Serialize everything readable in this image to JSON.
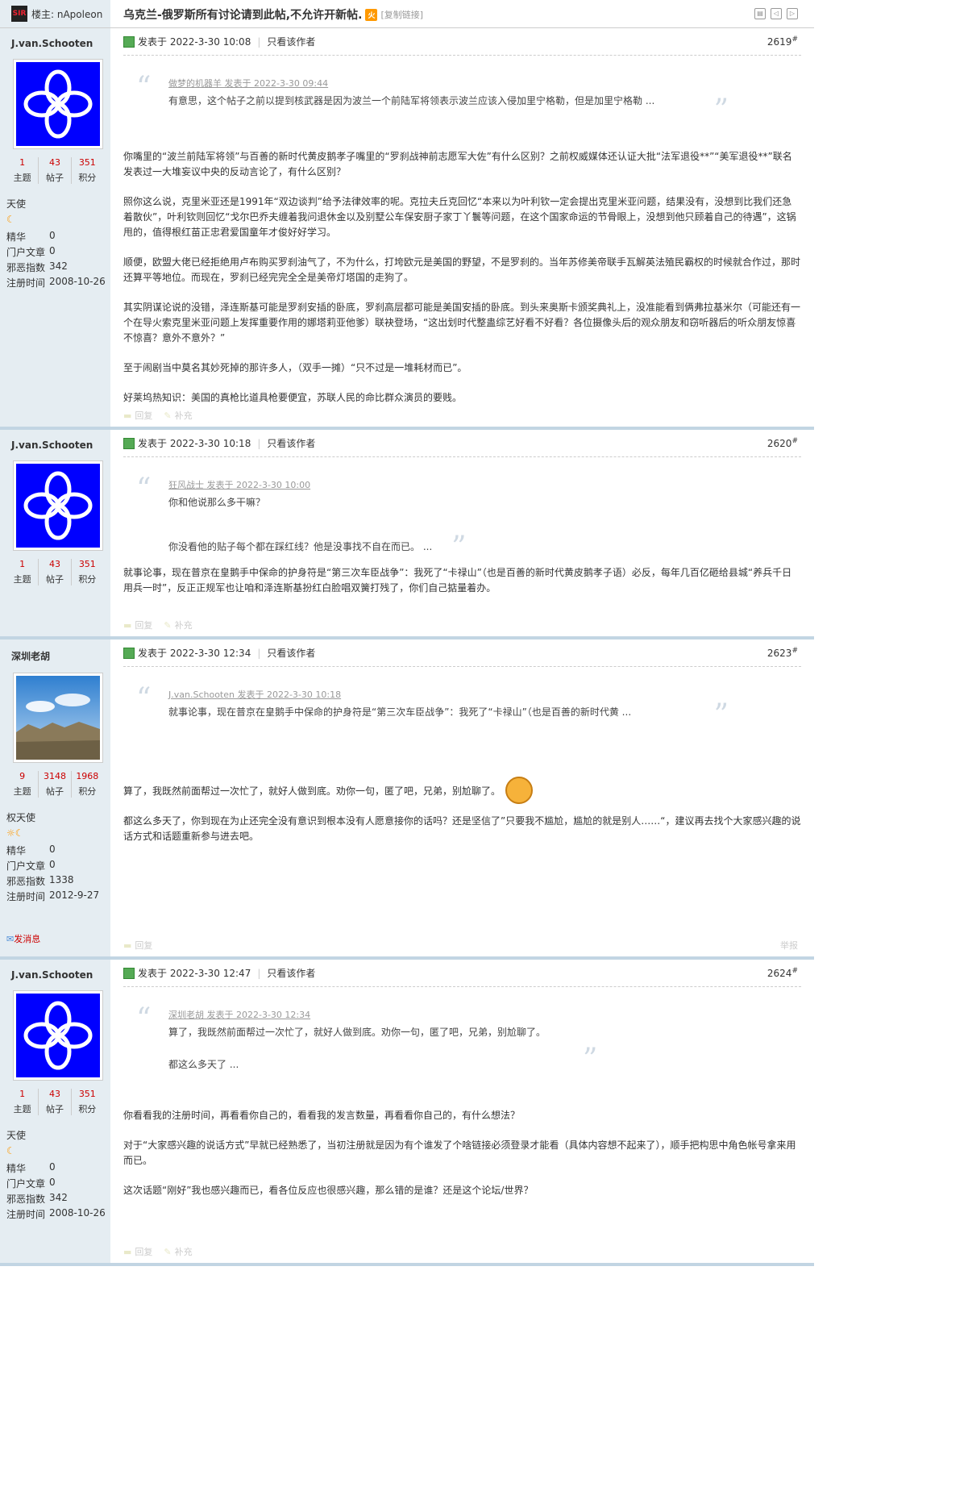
{
  "header": {
    "host_label": "楼主: nApoleon",
    "host_avatar_text": "SIR",
    "title": "乌克兰-俄罗斯所有讨论请到此帖,不允许开新帖.",
    "hot_badge": "火",
    "copy_link": "[复制链接]"
  },
  "labels": {
    "posted_prefix": "发表于 ",
    "only_author": "只看该作者",
    "reply": "回复",
    "supplement": "补充",
    "report": "举报",
    "topics": "主题",
    "posts": "帖子",
    "points": "积分",
    "essence": "精华",
    "portal": "门户文章",
    "evil": "邪恶指数",
    "reg": "注册时间",
    "send_msg": "发消息"
  },
  "posts": [
    {
      "username": "J.van.Schooten",
      "topics": "1",
      "posts_count": "43",
      "points": "351",
      "rank": "天使",
      "essence": "0",
      "portal": "0",
      "evil": "342",
      "reg": "2008-10-26",
      "time": "2022-3-30 10:08",
      "floor": "2619",
      "quote_author": "做梦的机器羊 发表于 2022-3-30 09:44",
      "quote_lines": [
        "有意思，这个帖子之前以提到核武器是因为波兰一个前陆军将领表示波兰应该入侵加里宁格勒，但是加里宁格勒 ..."
      ],
      "paragraphs": [
        "你嘴里的“波兰前陆军将领”与百善的新时代黄皮鹅孝子嘴里的“罗刹战神前志愿军大佐”有什么区别？之前权威媒体还认证大批“法军退役**”“美军退役**”联名发表过一大堆妄议中央的反动言论了，有什么区别？",
        "照你这么说，克里米亚还是1991年“双边谈判”给予法律效率的呢。克拉夫丘克回忆“本来以为叶利钦一定会提出克里米亚问题，结果没有，没想到比我们还急着散伙”，叶利钦则回忆“戈尔巴乔夫缠着我问退休金以及别墅公车保安厨子家丁丫鬟等问题，在这个国家命运的节骨眼上，没想到他只顾着自己的待遇”，这锅甩的，值得根红苗正忠君爱国童年才俊好好学习。",
        "顺便，欧盟大佬已经拒绝用卢布购买罗刹油气了，不为什么，打垮欧元是美国的野望，不是罗刹的。当年苏修美帝联手瓦解英法殖民霸权的时候就合作过，那时还算平等地位。而现在，罗刹已经完完全全是美帝灯塔国的走狗了。",
        "其实阴谋论说的没错，泽连斯基可能是罗刹安插的卧底，罗刹高层都可能是美国安插的卧底。到头来奥斯卡颁奖典礼上，没准能看到俩弗拉基米尔（可能还有一个在导火索克里米亚问题上发挥重要作用的娜塔莉亚他爹）联袂登场，“这出划时代整蛊综艺好看不好看？各位摄像头后的观众朋友和窃听器后的听众朋友惊喜不惊喜？意外不意外？”",
        "至于闹剧当中莫名其妙死掉的那许多人，（双手一摊）“只不过是一堆耗材而已”。",
        "好莱坞热知识：美国的真枪比道具枪要便宜，苏联人民的命比群众演员的要贱。"
      ]
    },
    {
      "username": "J.van.Schooten",
      "topics": "1",
      "posts_count": "43",
      "points": "351",
      "time": "2022-3-30 10:18",
      "floor": "2620",
      "quote_author": "狂风战士 发表于 2022-3-30 10:00",
      "quote_lines": [
        "你和他说那么多干嘛？",
        "你没看他的贴子每个都在踩红线？他是没事找不自在而已。 ..."
      ],
      "paragraphs": [
        "就事论事，现在普京在皇鹅手中保命的护身符是“第三次车臣战争”：我死了“卡禄山”（也是百善的新时代黄皮鹅孝子语）必反，每年几百亿砸给县城“养兵千日用兵一时”，反正正规军也让咱和泽连斯基扮红白脸唱双簧打残了，你们自己掂量着办。"
      ]
    },
    {
      "username": "深圳老胡",
      "topics": "9",
      "posts_count": "3148",
      "points": "1968",
      "rank": "权天使",
      "essence": "0",
      "portal": "0",
      "evil": "1338",
      "reg": "2012-9-27",
      "time": "2022-3-30 12:34",
      "floor": "2623",
      "quote_author": "J.van.Schooten 发表于 2022-3-30 10:18",
      "quote_lines": [
        "就事论事，现在普京在皇鹅手中保命的护身符是“第三次车臣战争”：我死了“卡禄山”（也是百善的新时代黄 ..."
      ],
      "paragraphs": [
        "算了，我既然前面帮过一次忙了，就好人做到底。劝你一句，匿了吧，兄弟，别尬聊了。",
        "都这么多天了，你到现在为止还完全没有意识到根本没有人愿意接你的话吗？还是坚信了”只要我不尴尬，尴尬的就是别人……“，建议再去找个大家感兴趣的说话方式和话题重新参与进去吧。"
      ]
    },
    {
      "username": "J.van.Schooten",
      "topics": "1",
      "posts_count": "43",
      "points": "351",
      "rank": "天使",
      "essence": "0",
      "portal": "0",
      "evil": "342",
      "reg": "2008-10-26",
      "time": "2022-3-30 12:47",
      "floor": "2624",
      "quote_author": "深圳老胡 发表于 2022-3-30 12:34",
      "quote_lines": [
        "算了，我既然前面帮过一次忙了，就好人做到底。劝你一句，匿了吧，兄弟，别尬聊了。",
        "都这么多天了 ..."
      ],
      "paragraphs": [
        "你看看我的注册时间，再看看你自己的，看看我的发言数量，再看看你自己的，有什么想法？",
        "对于“大家感兴趣的说话方式”早就已经熟悉了，当初注册就是因为有个谁发了个啥链接必须登录才能看（具体内容想不起来了），顺手把构思中角色帐号拿来用而已。",
        "这次话题“刚好”我也感兴趣而已，看各位反应也很感兴趣，那么错的是谁？还是这个论坛/世界？"
      ]
    }
  ]
}
